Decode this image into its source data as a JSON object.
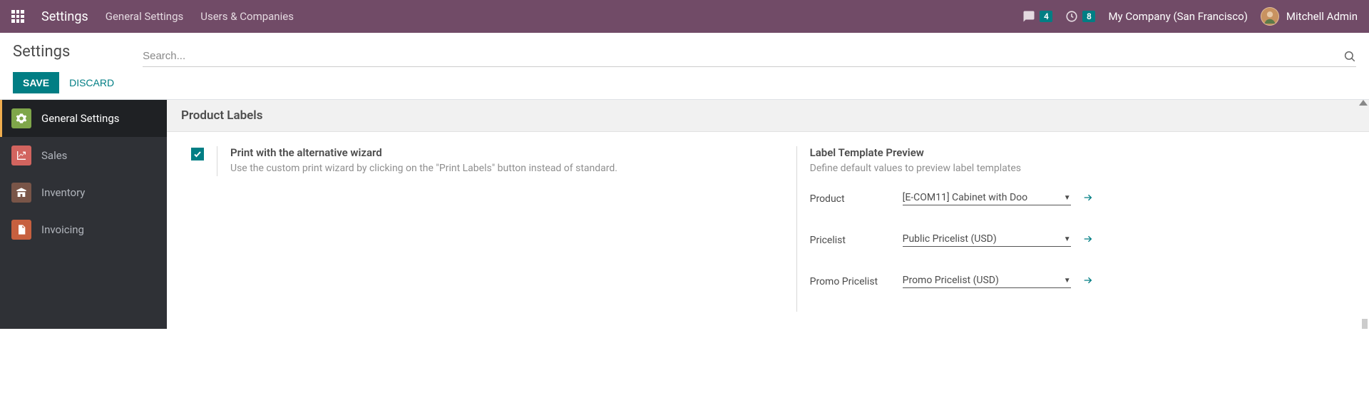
{
  "nav": {
    "title": "Settings",
    "links": [
      "General Settings",
      "Users & Companies"
    ],
    "messages_badge": "4",
    "activities_badge": "8",
    "company": "My Company (San Francisco)",
    "user": "Mitchell Admin"
  },
  "control": {
    "title": "Settings",
    "save_label": "SAVE",
    "discard_label": "DISCARD",
    "search_placeholder": "Search..."
  },
  "sidebar": {
    "items": [
      {
        "label": "General Settings"
      },
      {
        "label": "Sales"
      },
      {
        "label": "Inventory"
      },
      {
        "label": "Invoicing"
      }
    ]
  },
  "section": {
    "heading": "Product Labels",
    "left": {
      "label": "Print with the alternative wizard",
      "desc": "Use the custom print wizard by clicking on the \"Print Labels\" button instead of standard."
    },
    "right": {
      "label": "Label Template Preview",
      "desc": "Define default values to preview label templates",
      "fields": [
        {
          "label": "Product",
          "value": "[E-COM11] Cabinet with Doo"
        },
        {
          "label": "Pricelist",
          "value": "Public Pricelist (USD)"
        },
        {
          "label": "Promo Pricelist",
          "value": "Promo Pricelist (USD)"
        }
      ]
    }
  }
}
